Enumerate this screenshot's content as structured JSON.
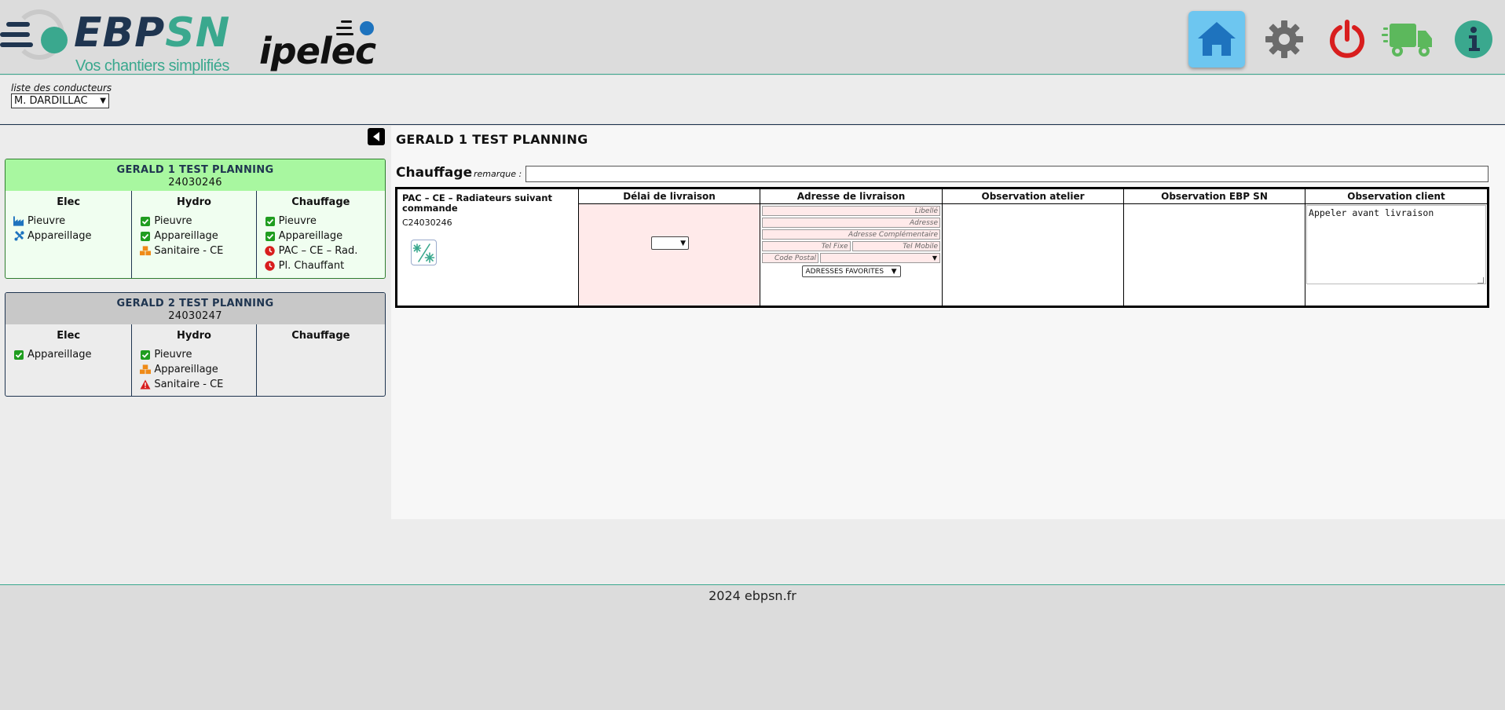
{
  "header": {
    "logo_ebp": {
      "ebp": "EBP",
      "sn": "SN",
      "tagline": "Vos chantiers simplifiés"
    },
    "logo_ipelec": "ipelec",
    "nav": [
      {
        "name": "home-icon",
        "color": "#1e73be"
      },
      {
        "name": "gear-icon",
        "color": "#6b6b6b"
      },
      {
        "name": "power-icon",
        "color": "#d81e1e"
      },
      {
        "name": "truck-icon",
        "color": "#5cb85c"
      },
      {
        "name": "info-icon",
        "color": "#3aa88e"
      }
    ]
  },
  "drivers": {
    "label": "liste des conducteurs",
    "selected": "M. DARDILLAC"
  },
  "projects": [
    {
      "title": "GERALD 1 TEST PLANNING",
      "number": "24030246",
      "columns": [
        {
          "title": "Elec",
          "items": [
            {
              "label": "Pieuvre",
              "icon": "factory-icon",
              "color": "#1e73be"
            },
            {
              "label": "Appareillage",
              "icon": "tools-icon",
              "color": "#1e73be"
            }
          ]
        },
        {
          "title": "Hydro",
          "items": [
            {
              "label": "Pieuvre",
              "icon": "check-icon",
              "color": "#1f9d1f"
            },
            {
              "label": "Appareillage",
              "icon": "check-icon",
              "color": "#1f9d1f"
            },
            {
              "label": "Sanitaire - CE",
              "icon": "boxes-icon",
              "color": "#ef8a17"
            }
          ]
        },
        {
          "title": "Chauffage",
          "items": [
            {
              "label": "Pieuvre",
              "icon": "check-icon",
              "color": "#1f9d1f"
            },
            {
              "label": "Appareillage",
              "icon": "check-icon",
              "color": "#1f9d1f"
            },
            {
              "label": "PAC – CE – Rad.",
              "icon": "clock-icon",
              "color": "#d81e1e"
            },
            {
              "label": "Pl. Chauffant",
              "icon": "clock-icon",
              "color": "#d81e1e"
            }
          ]
        }
      ]
    },
    {
      "title": "GERALD 2 TEST PLANNING",
      "number": "24030247",
      "columns": [
        {
          "title": "Elec",
          "items": [
            {
              "label": "Appareillage",
              "icon": "check-icon",
              "color": "#1f9d1f"
            }
          ]
        },
        {
          "title": "Hydro",
          "items": [
            {
              "label": "Pieuvre",
              "icon": "check-icon",
              "color": "#1f9d1f"
            },
            {
              "label": "Appareillage",
              "icon": "boxes-icon",
              "color": "#ef8a17"
            },
            {
              "label": "Sanitaire - CE",
              "icon": "warning-icon",
              "color": "#d81e1e"
            }
          ]
        },
        {
          "title": "Chauffage",
          "items": []
        }
      ]
    }
  ],
  "main": {
    "project_title": "GERALD 1 TEST PLANNING",
    "section": "Chauffage",
    "remark_label": "remarque :",
    "remark_value": "",
    "table": {
      "product_name": "PAC – CE – Radiateurs suivant commande",
      "product_code": "C24030246",
      "headers": {
        "delay": "Délai de livraison",
        "address": "Adresse de livraison",
        "obs_atelier": "Observation atelier",
        "obs_ebp": "Observation EBP SN",
        "obs_client": "Observation client"
      },
      "address_placeholders": {
        "libelle": "Libellé",
        "adresse": "Adresse",
        "complement": "Adresse Complémentaire",
        "tel_fixe": "Tel Fixe",
        "tel_mobile": "Tel Mobile",
        "code_postal": "Code Postal"
      },
      "favorites": "ADRESSES FAVORITES",
      "obs_client_value": "Appeler avant livraison"
    }
  },
  "footer": {
    "text": "2024 ebpsn.fr"
  }
}
